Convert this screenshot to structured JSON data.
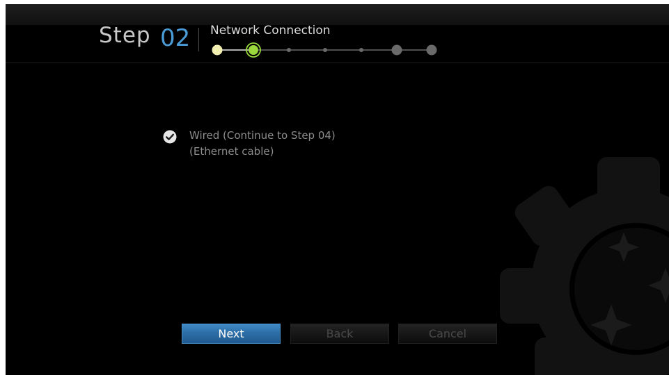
{
  "header": {
    "step_word": "Step",
    "step_number": "02",
    "title": "Network Connection"
  },
  "progress": {
    "total_steps": 7,
    "current_step": 2,
    "completed_color": "#f3efb0",
    "current_color": "#9ad83c",
    "pending_color": "#6a6a6a"
  },
  "option": {
    "icon": "check-circle-icon",
    "line1": "Wired (Continue to Step 04)",
    "line2": "(Ethernet cable)",
    "selected": true
  },
  "buttons": {
    "next_label": "Next",
    "back_label": "Back",
    "cancel_label": "Cancel"
  },
  "colors": {
    "accent": "#4a9bd6",
    "button_primary": "#2d6ea7"
  }
}
